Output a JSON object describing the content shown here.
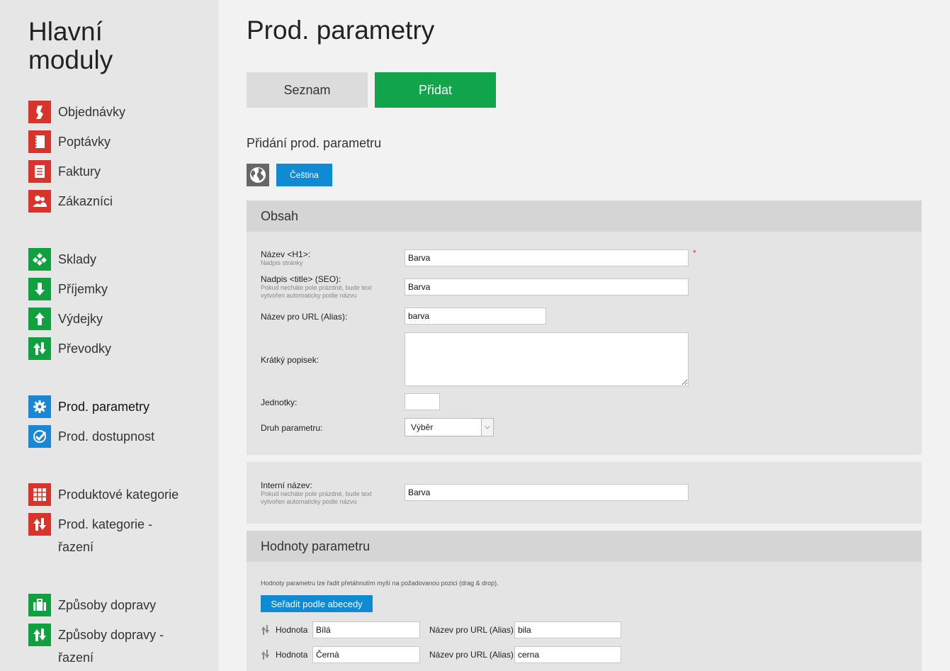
{
  "sidebar": {
    "title_line1": "Hlavní",
    "title_line2": "moduly",
    "items": [
      {
        "label": "Objednávky"
      },
      {
        "label": "Poptávky"
      },
      {
        "label": "Faktury"
      },
      {
        "label": "Zákazníci"
      },
      {
        "label": "Sklady"
      },
      {
        "label": "Příjemky"
      },
      {
        "label": "Výdejky"
      },
      {
        "label": "Převodky"
      },
      {
        "label": "Prod. parametry"
      },
      {
        "label": "Prod. dostupnost"
      },
      {
        "label": "Produktové kategorie"
      },
      {
        "label_line1": "Prod. kategorie -",
        "label_line2": "řazení"
      },
      {
        "label": "Způsoby dopravy"
      },
      {
        "label_line1": "Způsoby dopravy -",
        "label_line2": "řazení"
      }
    ]
  },
  "page": {
    "title": "Prod. parametry",
    "tab_list": "Seznam",
    "tab_add": "Přidat",
    "subtitle": "Přidání prod. parametru",
    "language": "Čeština"
  },
  "content_panel": {
    "heading": "Obsah",
    "name_label": "Název <H1>:",
    "name_hint": "Nadpis stránky",
    "name_value": "Barva",
    "required_mark": "*",
    "seo_label": "Nadpis <title> (SEO):",
    "seo_hint_line1": "Pokud necháte pole prázdné, bude text",
    "seo_hint_line2": "vytvořen automaticky podle názvu",
    "seo_value": "Barva",
    "alias_label": "Název pro URL (Alias):",
    "alias_value": "barva",
    "short_desc_label": "Krátký popisek:",
    "short_desc_value": "",
    "units_label": "Jednotky:",
    "units_value": "",
    "type_label": "Druh parametru:",
    "type_value": "Výběr"
  },
  "internal_panel": {
    "label": "Interní název:",
    "hint_line1": "Pokud necháte pole prázdné, bude text",
    "hint_line2": "vytvořen automaticky podle názvu",
    "value": "Barva"
  },
  "values_panel": {
    "heading": "Hodnoty parametru",
    "note": "Hodnoty parametru lze řadit přetáhnutím myší na požadovanou pozici (drag & drop).",
    "sort_button": "Seřadit podle abecedy",
    "value_label": "Hodnota",
    "alias_label": "Název pro URL (Alias)",
    "rows": [
      {
        "value": "Bílá",
        "alias": "bila"
      },
      {
        "value": "Černá",
        "alias": "cerna"
      }
    ]
  },
  "colors": {
    "red": "#d9342b",
    "green": "#11a44a",
    "blue": "#0f8bd6"
  }
}
